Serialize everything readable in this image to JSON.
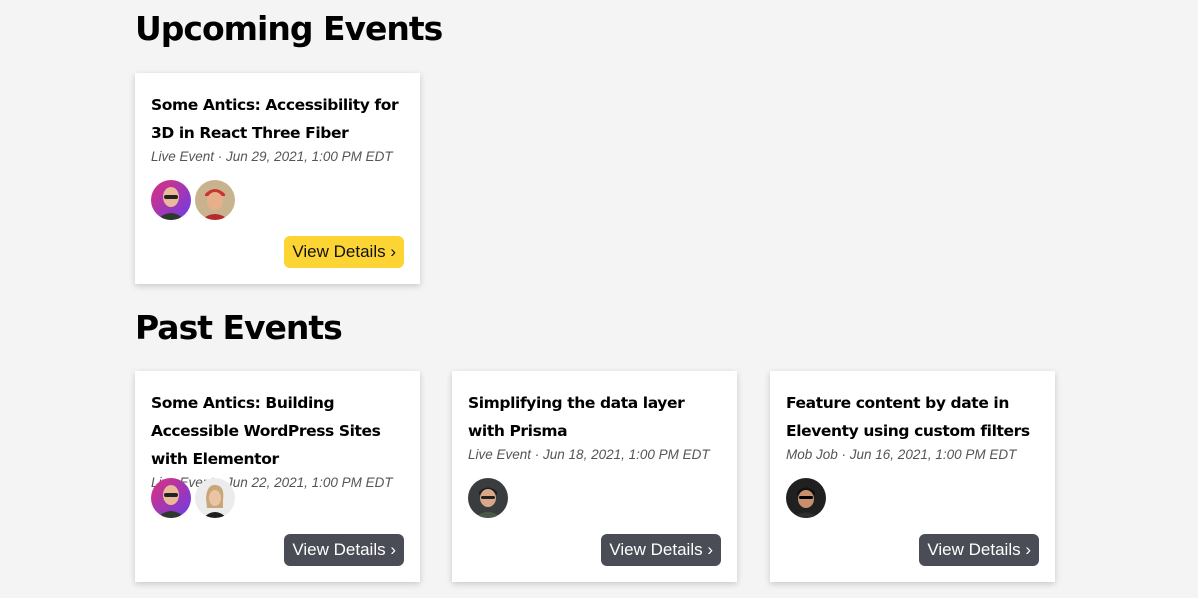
{
  "upcoming": {
    "heading": "Upcoming Events",
    "events": [
      {
        "title": "Some Antics: Accessibility for 3D in React Three Fiber",
        "meta": "Live Event · Jun 29, 2021, 1:00 PM EDT",
        "button": "View Details ›",
        "avatars": [
          "host-avatar",
          "guest-avatar"
        ]
      }
    ]
  },
  "past": {
    "heading": "Past Events",
    "events": [
      {
        "title": "Some Antics: Building Accessible WordPress Sites with Elementor",
        "meta": "Live Event · Jun 22, 2021, 1:00 PM EDT",
        "button": "View Details ›",
        "avatars": [
          "host-avatar",
          "guest-avatar"
        ]
      },
      {
        "title": "Simplifying the data layer with Prisma",
        "meta": "Live Event · Jun 18, 2021, 1:00 PM EDT",
        "button": "View Details ›",
        "avatars": [
          "guest-avatar"
        ]
      },
      {
        "title": "Feature content by date in Eleventy using custom filters",
        "meta": "Mob Job · Jun 16, 2021, 1:00 PM EDT",
        "button": "View Details ›",
        "avatars": [
          "guest-avatar"
        ]
      }
    ]
  },
  "colors": {
    "primary_button": "#fcd535",
    "secondary_button": "#4a4d55",
    "background": "#f4f4f4"
  }
}
